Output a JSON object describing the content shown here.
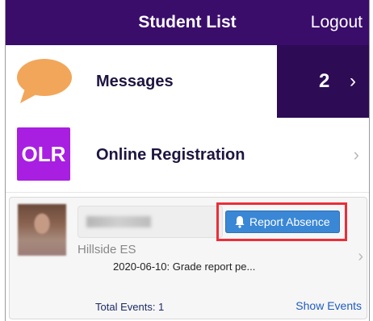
{
  "header": {
    "title": "Student List",
    "logout_label": "Logout"
  },
  "messages": {
    "label": "Messages",
    "count": "2",
    "icon": "speech-bubble-icon",
    "chevron": "›"
  },
  "online_registration": {
    "icon_text": "OLR",
    "label": "Online Registration",
    "chevron": "›"
  },
  "student_card": {
    "report_absence_label": "Report Absence",
    "school": "Hillside ES",
    "event": "2020-06-10: Grade report pe...",
    "total_events": "Total Events: 1",
    "show_events_label": "Show Events",
    "chevron": "›"
  },
  "colors": {
    "header_bg": "#3a0d6b",
    "message_count_bg": "#2d0c55",
    "olr_bg": "#a81fe2",
    "bubble": "#f2a65a",
    "report_button": "#3a87d6",
    "highlight_border": "#ec2d38"
  }
}
